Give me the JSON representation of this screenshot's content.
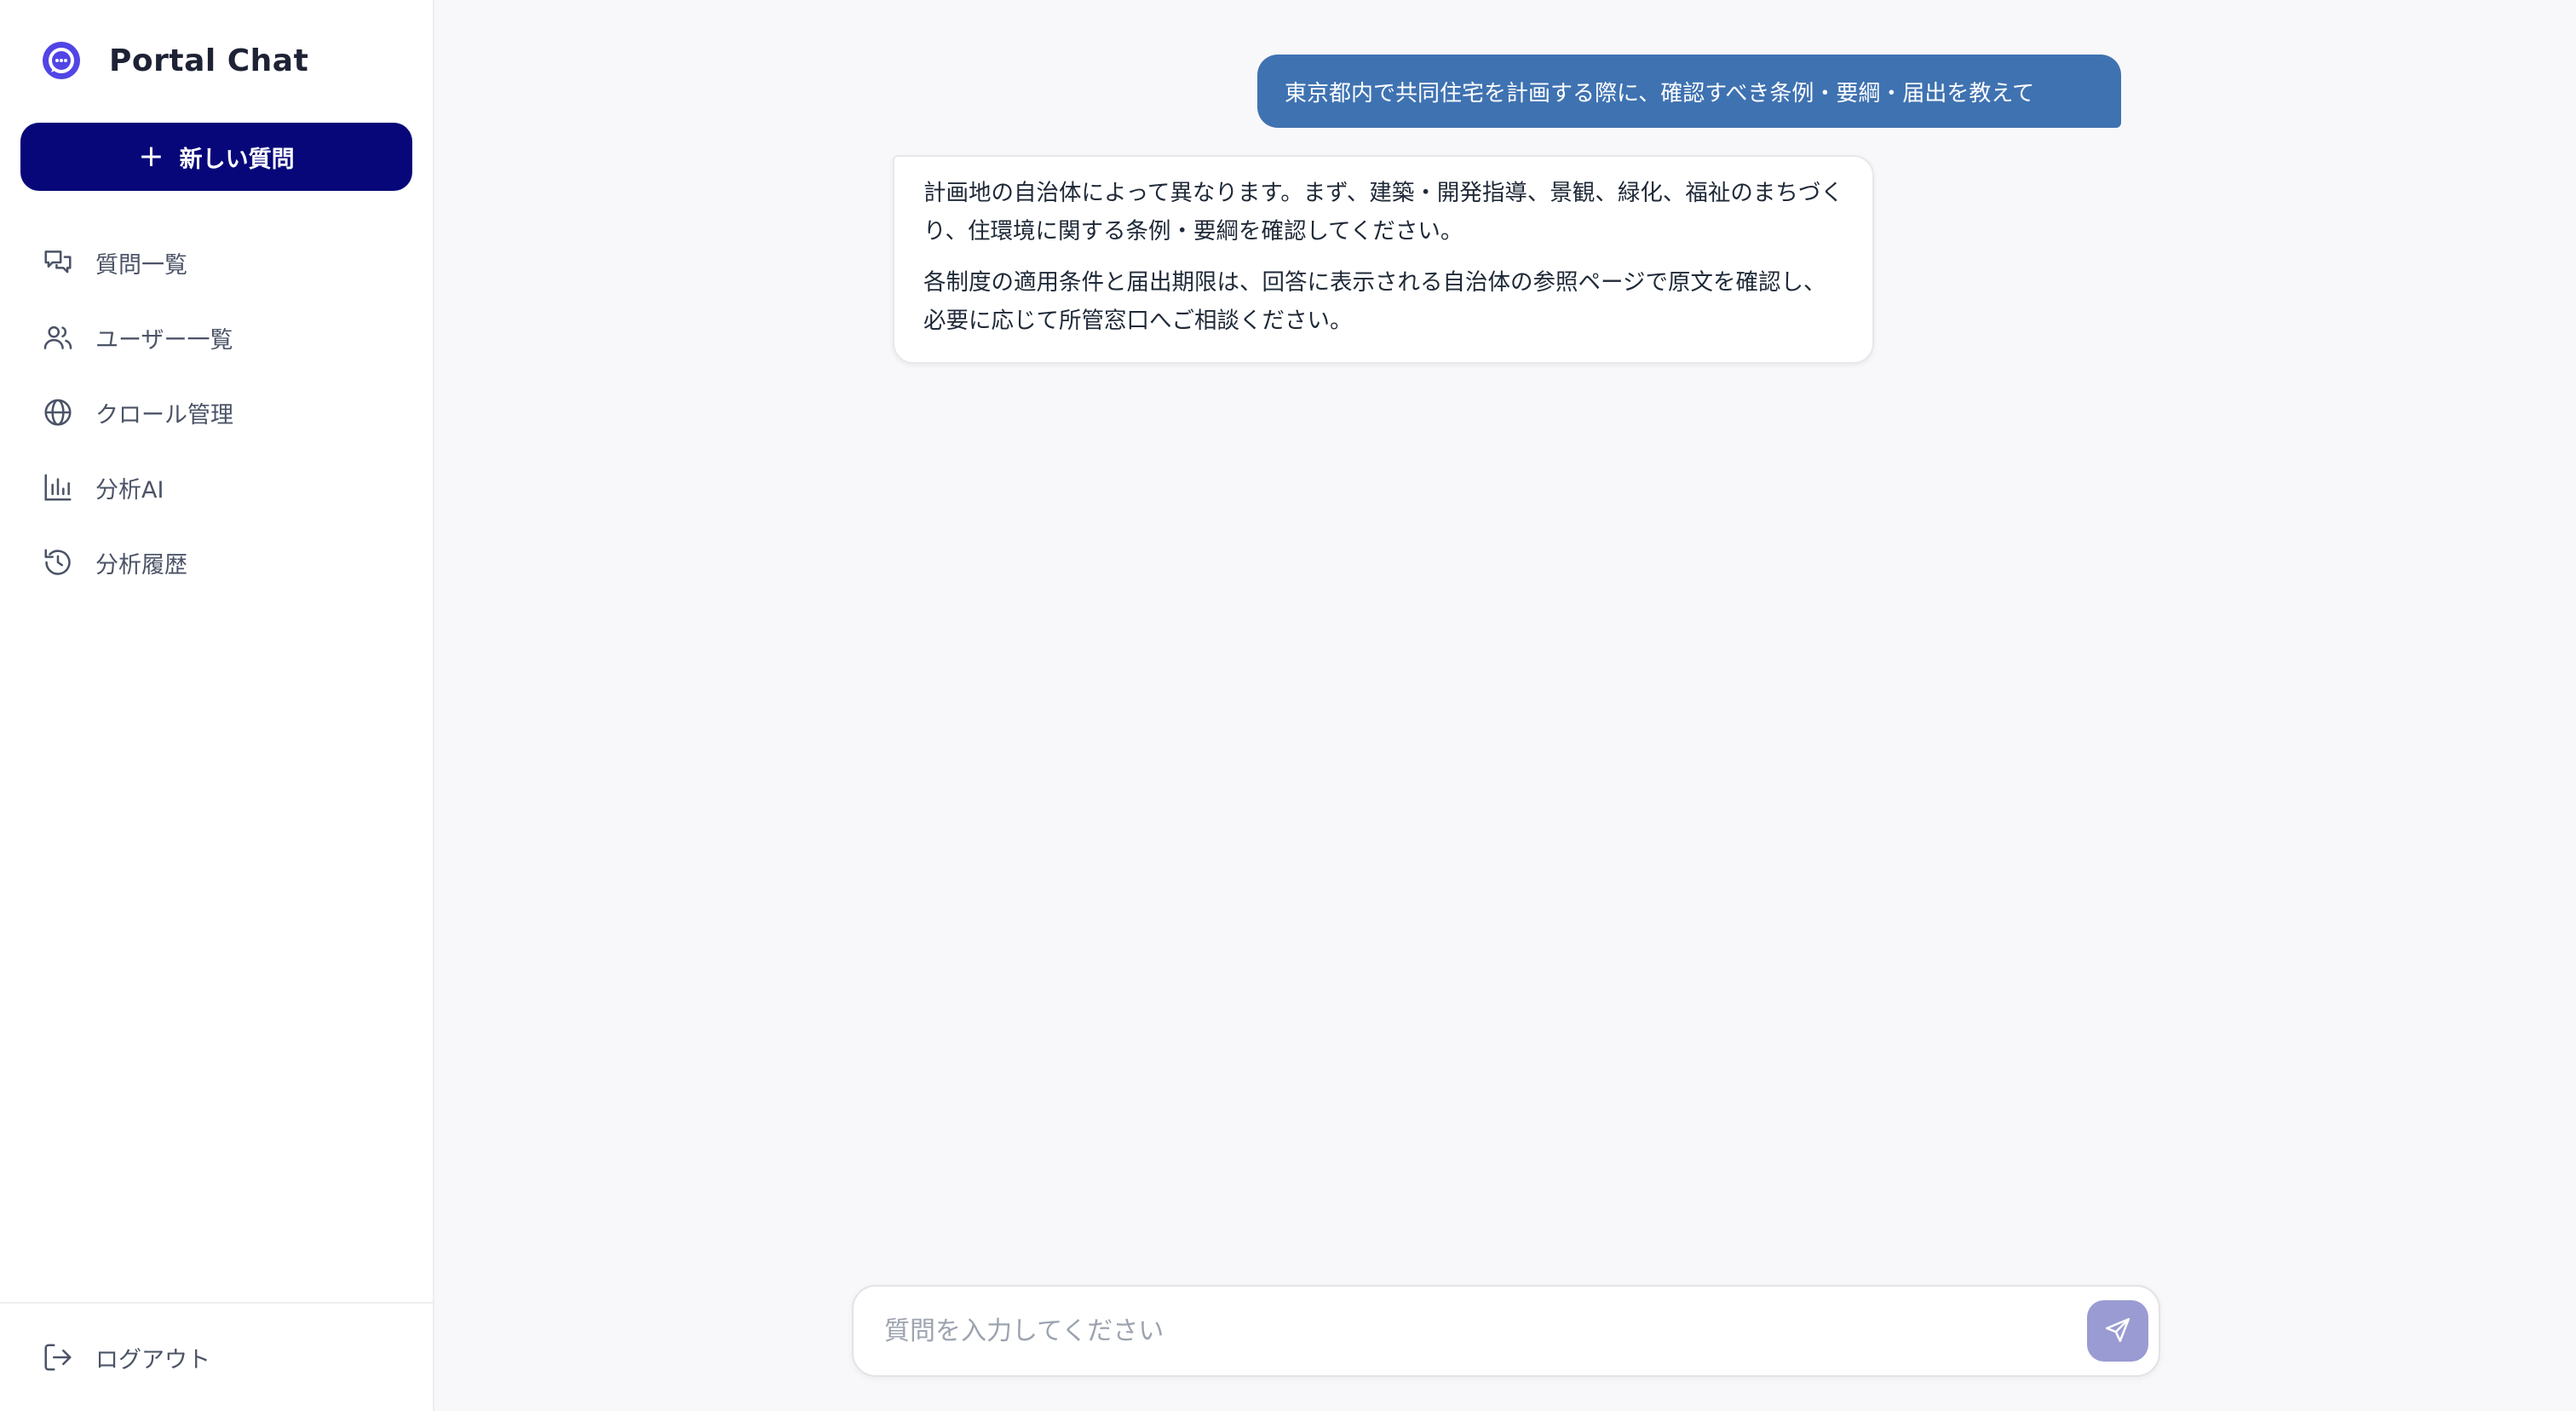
{
  "app": {
    "name": "Portal Chat"
  },
  "sidebar": {
    "new_button_label": "新しい質問",
    "items": [
      {
        "label": "質問一覧",
        "icon": "chat-bubbles-icon"
      },
      {
        "label": "ユーザー一覧",
        "icon": "users-icon"
      },
      {
        "label": "クロール管理",
        "icon": "globe-icon"
      },
      {
        "label": "分析AI",
        "icon": "bar-chart-icon"
      },
      {
        "label": "分析履歴",
        "icon": "history-icon"
      }
    ],
    "logout_label": "ログアウト"
  },
  "chat": {
    "messages": [
      {
        "role": "user",
        "text": "東京都内で共同住宅を計画する際に、確認すべき条例・要綱・届出を教えて"
      },
      {
        "role": "assistant",
        "paragraphs": [
          "計画地の自治体によって異なります。まず、建築・開発指導、景観、緑化、福祉のまちづくり、住環境に関する条例・要綱を確認してください。",
          "各制度の適用条件と届出期限は、回答に表示される自治体の参照ページで原文を確認し、必要に応じて所管窓口へご相談ください。"
        ]
      }
    ],
    "input_placeholder": "質問を入力してください",
    "input_value": ""
  },
  "colors": {
    "primary": "#07077a",
    "user_bubble": "#3f72b1",
    "send_button": "#9a9bd2",
    "logo": "#4f46e5"
  }
}
